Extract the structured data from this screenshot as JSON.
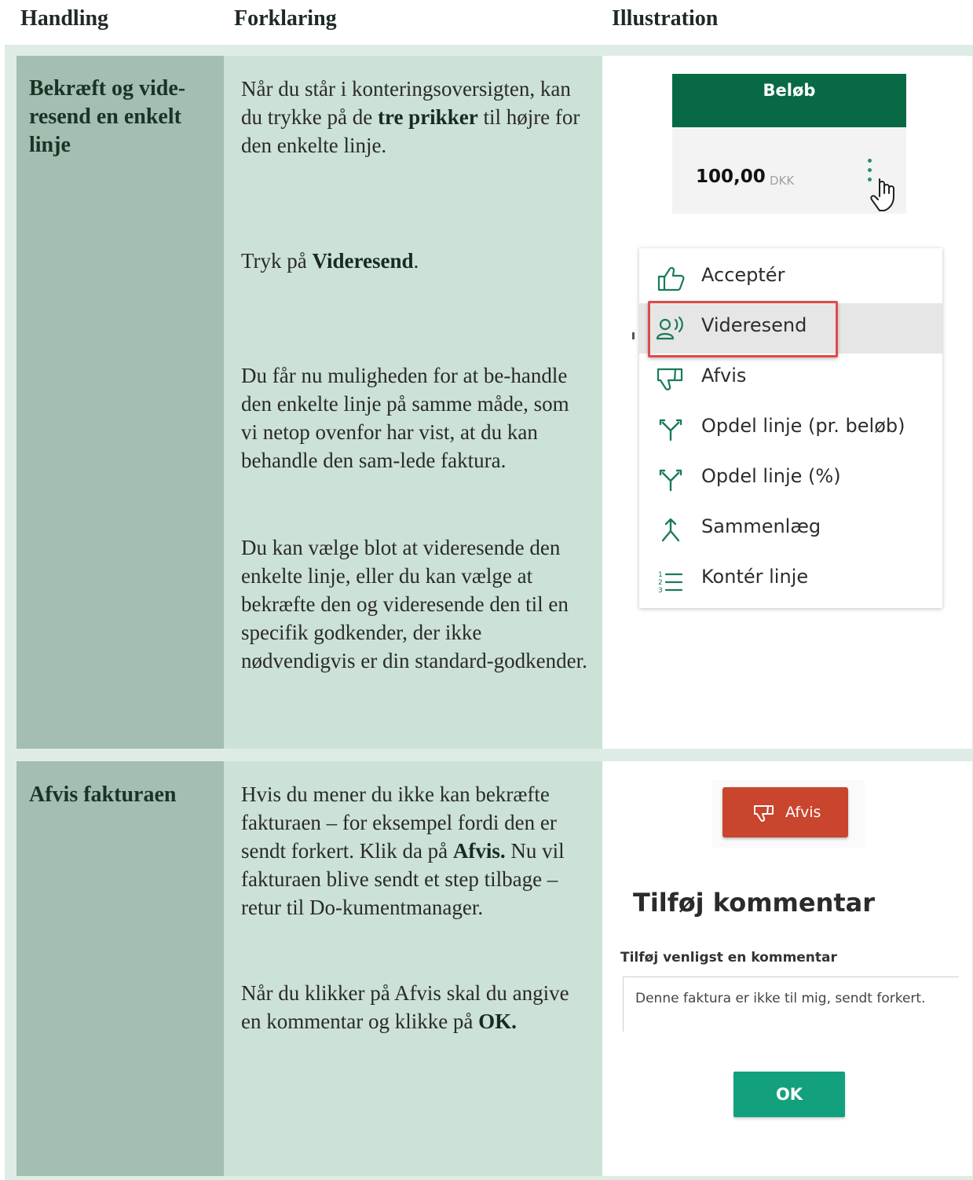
{
  "headers": {
    "handling": "Handling",
    "forklaring": "Forklaring",
    "illustration": "Illustration"
  },
  "row1": {
    "title": "Bekræft og vide-resend en enkelt linje",
    "text1_pre": "Når du står i konteringsoversigten, kan du trykke på de ",
    "text1_bold": "tre prikker",
    "text1_post": " til højre for den enkelte linje.",
    "text2_pre": "Tryk på ",
    "text2_bold": "Videresend",
    "text2_post": ".",
    "text3": "Du får nu muligheden for at be-handle den enkelte linje på samme måde, som vi netop ovenfor har vist, at du kan behandle den sam-lede faktura.",
    "text4": "Du kan vælge blot at videresende den enkelte linje, eller du kan vælge at bekræfte den og videresende den til en specifik godkender, der ikke nødvendigvis er din standard-godkender.",
    "amount": {
      "header": "Beløb",
      "value": "100,00",
      "currency": "DKK"
    },
    "menu": [
      {
        "label": "Acceptér",
        "icon": "thumbs-up-icon"
      },
      {
        "label": "Videresend",
        "icon": "forward-person-icon"
      },
      {
        "label": "Afvis",
        "icon": "thumbs-down-icon"
      },
      {
        "label": "Opdel linje (pr. beløb)",
        "icon": "split-icon"
      },
      {
        "label": "Opdel linje (%)",
        "icon": "split-icon"
      },
      {
        "label": "Sammenlæg",
        "icon": "merge-icon"
      },
      {
        "label": "Kontér linje",
        "icon": "numbered-list-icon"
      }
    ]
  },
  "row2": {
    "title": "Afvis fakturaen",
    "text1_pre": "Hvis du mener du ikke kan bekræfte fakturaen – for eksempel fordi den er sendt forkert. Klik da på ",
    "text1_bold": "Afvis.",
    "text1_post": " Nu vil fakturaen blive sendt et step tilbage – retur til Do-kumentmanager.",
    "text2_pre": "Når du klikker på Afvis skal du angive en kommentar og klikke på ",
    "text2_bold": "OK.",
    "afvis_button": "Afvis",
    "dialog_title": "Tilføj kommentar",
    "dialog_label": "Tilføj venligst en kommentar",
    "comment_value": "Denne faktura er ikke til mig, sendt forkert.",
    "ok_button": "OK"
  },
  "colors": {
    "accent_green": "#076a45",
    "reject_red": "#c9452d",
    "ok_green": "#12a17c"
  }
}
